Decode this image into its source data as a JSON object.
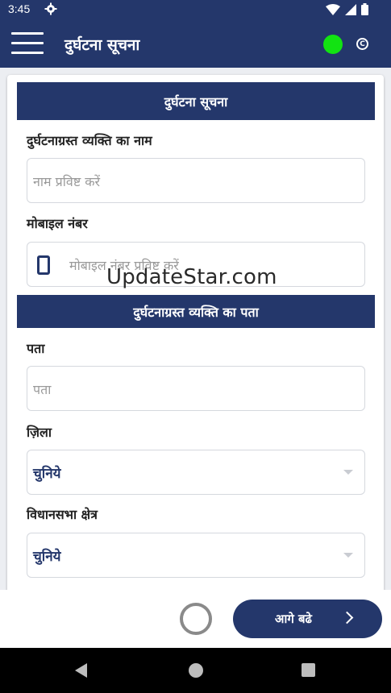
{
  "status_bar": {
    "time": "3:45"
  },
  "app_bar": {
    "title": "दुर्घटना सूचना",
    "connection_icon": "c-circle-icon"
  },
  "form": {
    "section1": {
      "title": "दुर्घटना सूचना",
      "name_label": "दुर्घटनाग्रस्त व्यक्ति का नाम",
      "name_placeholder": "नाम प्रविष्ट करें",
      "mobile_label": "मोबाइल नंबर",
      "mobile_placeholder": "मोबाइल नंबर प्रविष्ट करें"
    },
    "section2": {
      "title": "दुर्घटनाग्रस्त व्यक्ति का पता",
      "address_label": "पता",
      "address_placeholder": "पता",
      "district_label": "ज़िला",
      "district_value": "चुनिये",
      "assembly_label": "विधानसभा क्षेत्र",
      "assembly_value": "चुनिये"
    }
  },
  "watermark": "UpdateStar.com",
  "footer": {
    "next_label": "आगे बढे"
  },
  "colors": {
    "primary": "#24376b",
    "online": "#12e312",
    "background": "#eceef2"
  }
}
